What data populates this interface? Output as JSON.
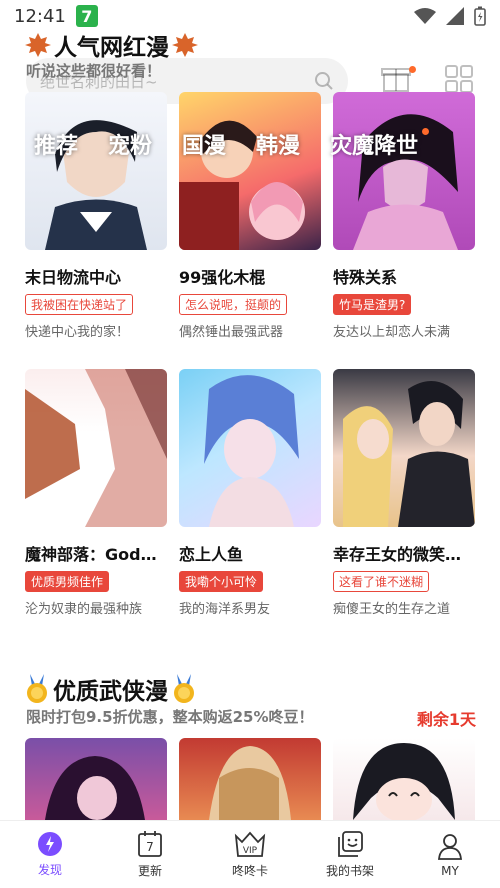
{
  "status_bar": {
    "time": "12:41",
    "app_badge": "7"
  },
  "header": {
    "search_placeholder": "绝世名刺的田日~"
  },
  "tabs": [
    {
      "label": "推荐"
    },
    {
      "label": "宠粉"
    },
    {
      "label": "国漫"
    },
    {
      "label": "韩漫"
    },
    {
      "label": "灾魔降世"
    }
  ],
  "section_popular": {
    "title": "人气网红漫",
    "subtitle": "听说这些都很好看！",
    "icon": "maple-leaf-icon",
    "cards": [
      {
        "title": "末日物流中心",
        "tag": "我被困在快递站了",
        "tag_style": "outline",
        "desc": "快递中心我的家！"
      },
      {
        "title": "99强化木棍",
        "tag": "怎么说呢，挺颠的",
        "tag_style": "outline",
        "desc": "偶然锤出最强武器"
      },
      {
        "title": "特殊关系",
        "tag": "竹马是渣男?",
        "tag_style": "filled",
        "desc": "友达以上却恋人未满"
      },
      {
        "title": "魔神部落：God…",
        "tag": "优质男频佳作",
        "tag_style": "filled",
        "desc": "沦为奴隶的最强种族"
      },
      {
        "title": "恋上人鱼",
        "tag": "我嘞个小可怜",
        "tag_style": "filled",
        "desc": "我的海洋系男友"
      },
      {
        "title": "幸存王女的微笑…",
        "tag": "这看了谁不迷糊",
        "tag_style": "outline",
        "desc": "痴傻王女的生存之道"
      }
    ]
  },
  "section_wuxia": {
    "title": "优质武侠漫",
    "subtitle": "限时打包9.5折优惠，整本购返25%咚豆！",
    "extra": "剩余1天",
    "icon": "gold-medal-icon"
  },
  "bottom_nav": [
    {
      "label": "发现",
      "icon": "discover-icon",
      "active": true
    },
    {
      "label": "更新",
      "icon": "calendar-icon",
      "active": false,
      "badge": "7"
    },
    {
      "label": "咚咚卡",
      "icon": "vip-crown-icon",
      "active": false,
      "badge": "VIP"
    },
    {
      "label": "我的书架",
      "icon": "bookshelf-icon",
      "active": false
    },
    {
      "label": "MY",
      "icon": "profile-icon",
      "active": false
    }
  ],
  "colors": {
    "accent": "#7b4dff",
    "tag_red": "#e8473b",
    "dot_orange": "#ff6a2b",
    "countdown_red": "#e63b2e"
  }
}
